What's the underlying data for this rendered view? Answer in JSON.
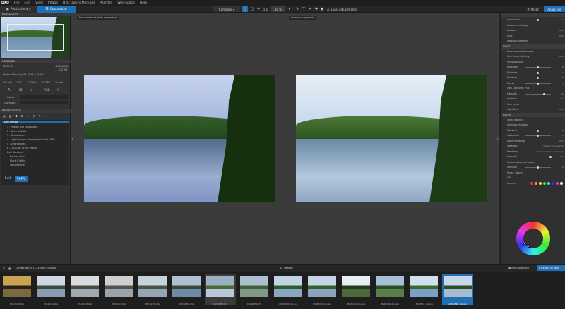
{
  "app": {
    "logo": "DXO"
  },
  "menu": [
    "File",
    "Edit",
    "View",
    "Image",
    "DxO Optics Modules",
    "Palettes",
    "Workspace",
    "Help"
  ],
  "tabs": {
    "library": "PhotoLibrary",
    "customize": "Customize"
  },
  "toolbar": {
    "compare": "Compare",
    "zoom": "1:1",
    "zoom_pct": "30 %",
    "local": "Local adjustments",
    "reset": "Reset",
    "apply": "Apply pre"
  },
  "preview_labels": {
    "left": "No corrections (with geometry)",
    "right": "Correction preview"
  },
  "left": {
    "moveZoom": "MOVE/ZOOM",
    "metadata": "METADATA",
    "camera": "LEICA X1",
    "dims": "4272x2848",
    "size": "7.02 MB",
    "date": "Shot on Mon, Aug 26, 2019 8:45 AM",
    "exif": [
      "ISO 200",
      "f/7.1",
      "1/250 s",
      "+0.3 EV",
      "24 mm"
    ],
    "exif_btns": [
      "A",
      "RGB"
    ],
    "author": "Author",
    "copyright": "Copyright",
    "presetEditor": "PRESET EDITOR",
    "presets": [
      "DxO presets",
      "1 - Portrait and Landscape",
      "2 - Black & White",
      "3 - Atmospheres",
      "4 - High Dynamic Range (single shot HDR)",
      "5 - Smartphones",
      "6 - DxO ONE Scene Modes",
      "DxO Standard",
      "Neutral colors",
      "Black & White",
      "No correction"
    ],
    "edit": "Edit",
    "apply": "Apply"
  },
  "right": {
    "rows": [
      {
        "t": "sec",
        "label": ""
      },
      {
        "t": "row",
        "label": "Luminance",
        "val": "0"
      },
      {
        "t": "row",
        "label": "Advanced settings",
        "val": ""
      },
      {
        "t": "row",
        "label": "Horizon",
        "val": "Auto"
      },
      {
        "t": "row",
        "label": "Crop",
        "val": "Auto"
      },
      {
        "t": "row",
        "label": "Local adjustments",
        "val": ""
      },
      {
        "t": "sec",
        "label": "LIGHT"
      },
      {
        "t": "row",
        "label": "Exposure compensation",
        "val": ""
      },
      {
        "t": "row",
        "label": "DxO Smart Lighting",
        "val": "Auto"
      },
      {
        "t": "row",
        "label": "Selective tone",
        "val": ""
      },
      {
        "t": "row",
        "label": "Highlights",
        "val": "0"
      },
      {
        "t": "row",
        "label": "Midtones",
        "val": "0"
      },
      {
        "t": "row",
        "label": "Shadows",
        "val": "0"
      },
      {
        "t": "row",
        "label": "Blacks",
        "val": "0"
      },
      {
        "t": "row",
        "label": "DxO ClearView Plus",
        "val": ""
      },
      {
        "t": "row",
        "label": "Intensity",
        "val": "50"
      },
      {
        "t": "row",
        "label": "Contrast",
        "val": "Auto"
      },
      {
        "t": "row",
        "label": "Tone curve",
        "val": ""
      },
      {
        "t": "row",
        "label": "Vignetting",
        "val": "Auto"
      },
      {
        "t": "sec",
        "label": "COLOR"
      },
      {
        "t": "row",
        "label": "White balance",
        "val": ""
      },
      {
        "t": "row",
        "label": "Color accentuation",
        "val": ""
      },
      {
        "t": "row",
        "label": "Vibrancy",
        "val": "0"
      },
      {
        "t": "row",
        "label": "Saturation",
        "val": "0"
      },
      {
        "t": "row",
        "label": "Color rendering",
        "val": "Auto"
      },
      {
        "t": "row",
        "label": "Category",
        "val": "Generic renderings"
      },
      {
        "t": "row",
        "label": "Rendering",
        "val": "Camera default rendering"
      },
      {
        "t": "row",
        "label": "Intensity",
        "val": "100"
      },
      {
        "t": "row",
        "label": "Protect saturated colors",
        "val": ""
      },
      {
        "t": "row",
        "label": "Intensity",
        "val": "0"
      },
      {
        "t": "row",
        "label": "Style - Toning",
        "val": ""
      },
      {
        "t": "row",
        "label": "HSL",
        "val": ""
      },
      {
        "t": "row",
        "label": "Channel",
        "val": ""
      }
    ],
    "channel_colors": [
      "#e33",
      "#e93",
      "#ee3",
      "#3e3",
      "#3ee",
      "#33e",
      "#e3e",
      "#eee"
    ]
  },
  "film": {
    "path": "Landscape > L1320560_dxo.jpg",
    "count": "14 images",
    "collection": "Nik Collection",
    "export": "Export to disk",
    "thumbs": [
      "DSC01263.JPG",
      "DSC01312.JPG",
      "DSC01316.JPG",
      "DSC01324.JPG",
      "DSC01355.JPG",
      "DSC01365.JPG",
      "DSC04853.JPG",
      "DSC04854.JPG",
      "IMGP0935_dxo.jpg",
      "IMGP0937_dxo.jpg",
      "IMGP1101_dxo.jpg",
      "IMGP1102_dxo.jpg",
      "L1320512_dxo.jpg",
      "L1320560_dxo.jpg"
    ]
  },
  "colors": {
    "accent": "#1e6fb4"
  }
}
